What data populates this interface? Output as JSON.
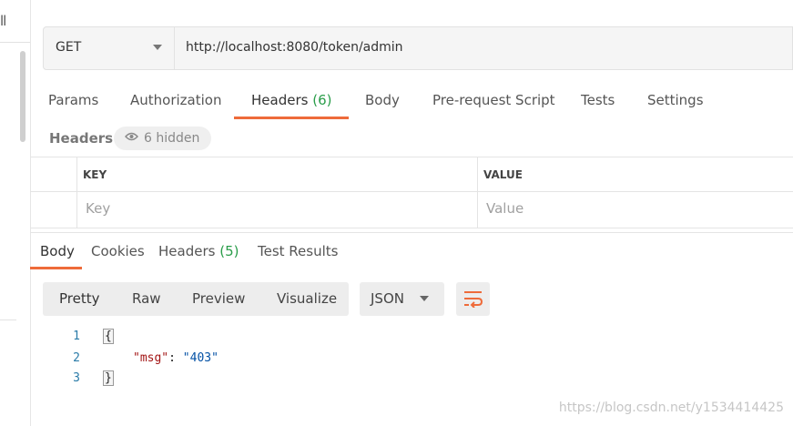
{
  "sidebar": {
    "glyph": "ll"
  },
  "request": {
    "method": "GET",
    "url": "http://localhost:8080/token/admin"
  },
  "request_tabs": {
    "params": "Params",
    "authorization": "Authorization",
    "headers": "Headers",
    "headers_count": "(6)",
    "body": "Body",
    "prerequest": "Pre-request Script",
    "tests": "Tests",
    "settings": "Settings",
    "active": "Headers"
  },
  "headers_section": {
    "title": "Headers",
    "hidden_badge": "6 hidden",
    "key_header": "KEY",
    "value_header": "VALUE",
    "key_placeholder": "Key",
    "value_placeholder": "Value"
  },
  "response_tabs": {
    "body": "Body",
    "cookies": "Cookies",
    "headers": "Headers",
    "headers_count": "(5)",
    "test_results": "Test Results",
    "active": "Body"
  },
  "view_modes": {
    "pretty": "Pretty",
    "raw": "Raw",
    "preview": "Preview",
    "visualize": "Visualize",
    "format": "JSON"
  },
  "response_body": {
    "line_numbers": [
      "1",
      "2",
      "3"
    ],
    "open_brace": "{",
    "key": "\"msg\"",
    "colon": ": ",
    "value": "\"403\"",
    "close_brace": "}"
  },
  "watermark": "https://blog.csdn.net/y1534414425",
  "colors": {
    "accent": "#ee6b3a",
    "count_green": "#2a9d4a",
    "line_number_blue": "#2a7ba8"
  }
}
